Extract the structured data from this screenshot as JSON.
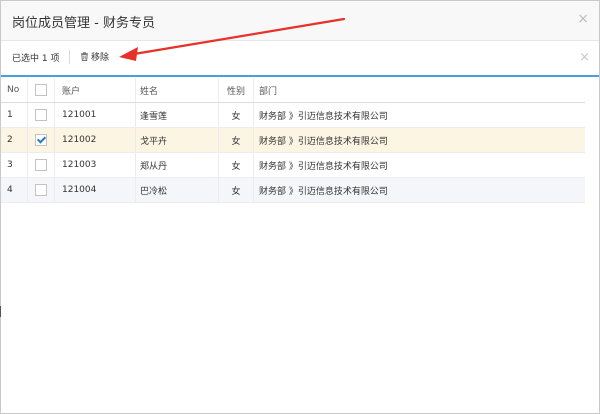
{
  "dialog": {
    "title": "岗位成员管理 - 财务专员",
    "close_glyph": "×"
  },
  "toolbar": {
    "selected_info": "已选中 1 项",
    "remove_label": "移除",
    "remove_icon": "trash-icon",
    "close_glyph": "×"
  },
  "table": {
    "columns": [
      "No",
      "",
      "账户",
      "姓名",
      "性别",
      "部门"
    ],
    "rows": [
      {
        "no": "1",
        "checked": false,
        "account": "121001",
        "name": "逢雪莲",
        "gender": "女",
        "dept": "财务部 》引迈信息技术有限公司"
      },
      {
        "no": "2",
        "checked": true,
        "account": "121002",
        "name": "戈平卉",
        "gender": "女",
        "dept": "财务部 》引迈信息技术有限公司"
      },
      {
        "no": "3",
        "checked": false,
        "account": "121003",
        "name": "郑从丹",
        "gender": "女",
        "dept": "财务部 》引迈信息技术有限公司"
      },
      {
        "no": "4",
        "checked": false,
        "account": "121004",
        "name": "巴冷松",
        "gender": "女",
        "dept": "财务部 》引迈信息技术有限公司"
      }
    ]
  },
  "colors": {
    "accent": "#4a9fd8",
    "annotation_arrow": "#e8302a",
    "selected_row": "#fdf5e4",
    "check": "#2a7ac9"
  }
}
